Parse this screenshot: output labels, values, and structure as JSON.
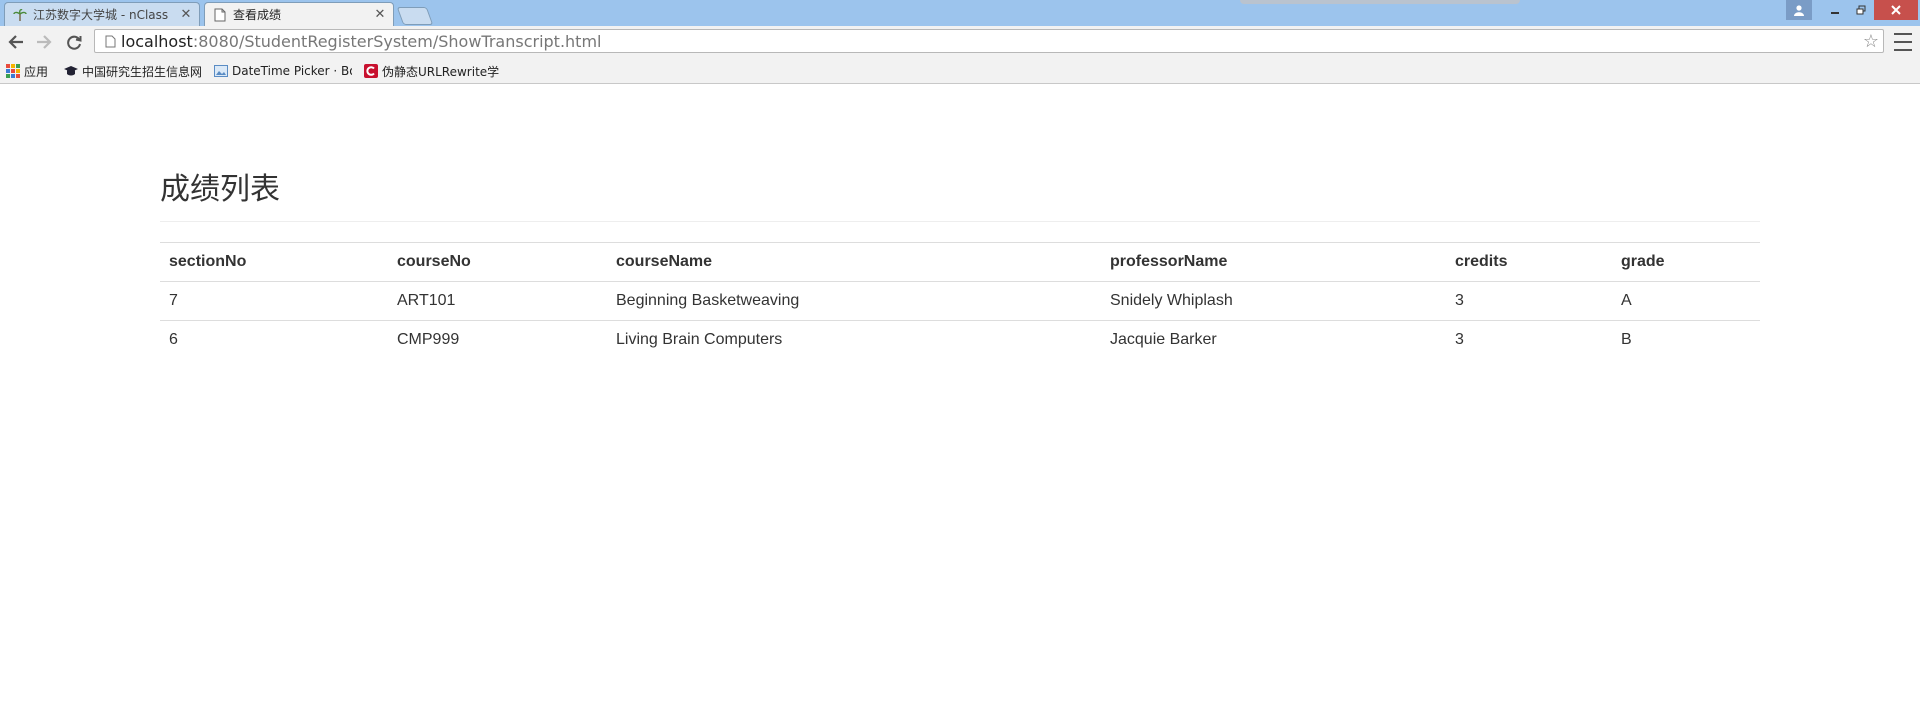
{
  "browser": {
    "tabs": [
      {
        "title": "江苏数字大学城 - nClass",
        "active": false
      },
      {
        "title": "查看成绩",
        "active": true
      }
    ],
    "url_host": "localhost",
    "url_rest": ":8080/StudentRegisterSystem/ShowTranscript.html",
    "bookmarks": [
      {
        "label": "应用",
        "icon": "apps-grid-icon"
      },
      {
        "label": "中国研究生招生信息网",
        "icon": "graduation-cap-icon"
      },
      {
        "label": "DateTime Picker · Bo",
        "icon": "image-icon"
      },
      {
        "label": "伪静态URLRewrite学",
        "icon": "red-c-icon"
      }
    ]
  },
  "page": {
    "title": "成绩列表",
    "table": {
      "headers": [
        "sectionNo",
        "courseNo",
        "courseName",
        "professorName",
        "credits",
        "grade"
      ],
      "rows": [
        [
          "7",
          "ART101",
          "Beginning Basketweaving",
          "Snidely Whiplash",
          "3",
          "A"
        ],
        [
          "6",
          "CMP999",
          "Living Brain Computers",
          "Jacquie Barker",
          "3",
          "B"
        ]
      ]
    }
  },
  "colors": {
    "tabstrip_bg": "#9cc4ed",
    "toolbar_bg": "#f2f2f2",
    "close_button": "#c7504c",
    "text": "#333333",
    "table_border": "#dddddd"
  }
}
